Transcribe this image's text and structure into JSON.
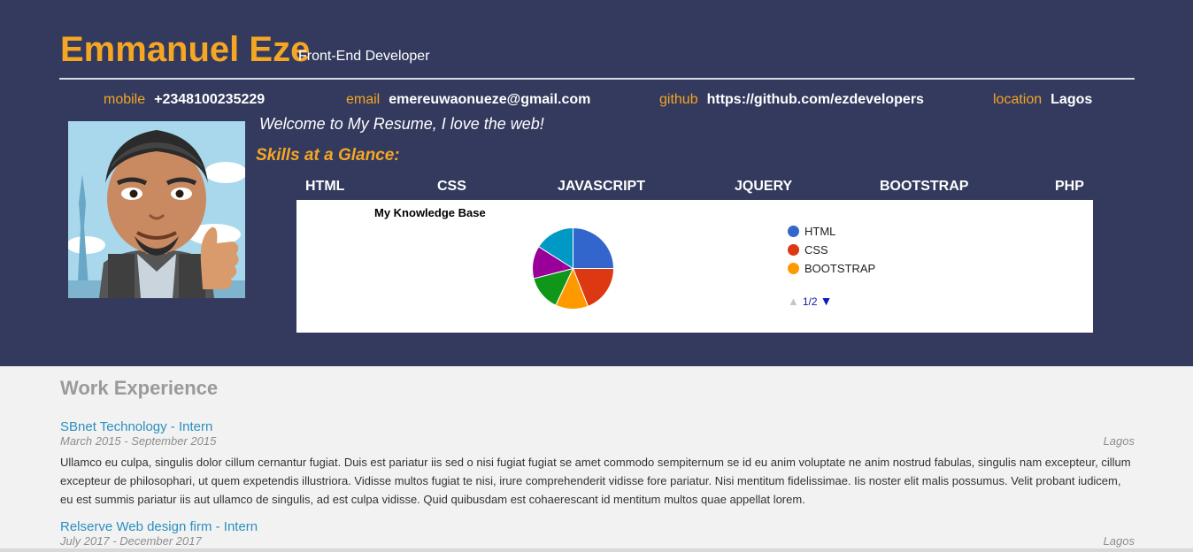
{
  "header": {
    "name": "Emmanuel Eze",
    "role": "Front-End Developer",
    "contacts": [
      {
        "label": "mobile",
        "value": "+2348100235229"
      },
      {
        "label": "email",
        "value": "emereuwaonueze@gmail.com"
      },
      {
        "label": "github",
        "value": "https://github.com/ezdevelopers"
      },
      {
        "label": "location",
        "value": "Lagos"
      }
    ],
    "welcome": "Welcome to My Resume, I love the web!",
    "skills_title": "Skills at a Glance:",
    "skills": [
      "HTML",
      "CSS",
      "JAVASCRIPT",
      "JQUERY",
      "BOOTSTRAP",
      "PHP"
    ]
  },
  "chart_data": {
    "type": "pie",
    "title": "My Knowledge Base",
    "slices": [
      {
        "name": "HTML",
        "value": 25,
        "color": "#3366cc"
      },
      {
        "name": "CSS",
        "value": 19,
        "color": "#dc3912"
      },
      {
        "name": "BOOTSTRAP",
        "value": 13,
        "color": "#ff9900"
      },
      {
        "name": "",
        "value": 14,
        "color": "#109618"
      },
      {
        "name": "",
        "value": 13,
        "color": "#990099"
      },
      {
        "name": "",
        "value": 16,
        "color": "#0099c6"
      }
    ],
    "legend": {
      "placement": "right",
      "visible": [
        "HTML",
        "CSS",
        "BOOTSTRAP"
      ],
      "page": "1/2"
    }
  },
  "work": {
    "title": "Work Experience",
    "jobs": [
      {
        "title": "SBnet Technology - Intern",
        "dates": "March 2015 - September 2015",
        "location": "Lagos",
        "description": "Ullamco eu culpa, singulis dolor cillum cernantur fugiat. Duis est pariatur iis sed o nisi fugiat fugiat se amet commodo sempiternum se id eu anim voluptate ne anim nostrud fabulas, singulis nam excepteur, cillum excepteur de philosophari, ut quem expetendis illustriora. Vidisse multos fugiat te nisi, irure comprehenderit vidisse fore pariatur. Nisi mentitum fidelissimae. Iis noster elit malis possumus. Velit probant iudicem, eu est summis pariatur iis aut ullamco de singulis, ad est culpa vidisse. Quid quibusdam est cohaerescant id mentitum multos quae appellat lorem."
      },
      {
        "title": "Relserve Web design firm - Intern",
        "dates": "July 2017 - December 2017",
        "location": "Lagos"
      }
    ]
  },
  "colors": {
    "header_bg": "#333a5e",
    "accent": "#f5a623",
    "link": "#2a8fbd",
    "body_bg": "#f2f2f2"
  }
}
